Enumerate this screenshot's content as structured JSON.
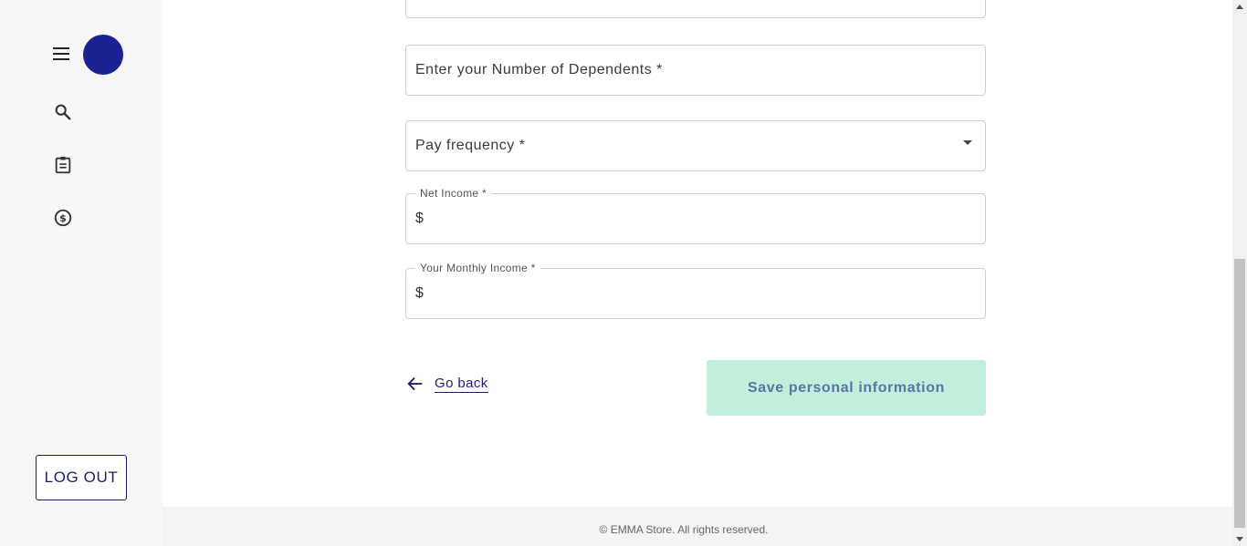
{
  "sidebar": {
    "logout_label": "LOG OUT",
    "avatar_color": "#1b2394",
    "icons": [
      "menu-icon",
      "search-icon",
      "clipboard-icon",
      "dollar-circle-icon"
    ]
  },
  "form": {
    "dependents_placeholder": "Enter your Number of Dependents *",
    "pay_frequency_label": "Pay frequency *",
    "net_income": {
      "label": "Net Income *",
      "prefix": "$",
      "value": ""
    },
    "monthly_income": {
      "label": "Your Monthly Income *",
      "prefix": "$",
      "value": ""
    },
    "go_back_label": "Go back",
    "save_label": "Save personal information",
    "save_color": "#c0efdb",
    "accent_color": "#1b1f6b"
  },
  "footer": {
    "text": "© EMMA Store. All rights reserved."
  }
}
